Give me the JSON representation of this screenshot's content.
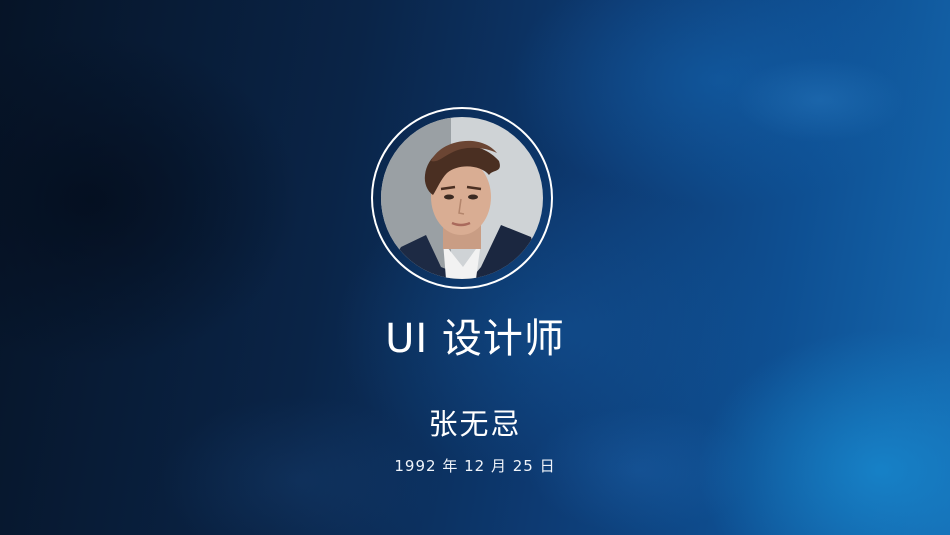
{
  "profile": {
    "title": "UI 设计师",
    "name": "张无忌",
    "birthdate": "1992 年 12 月 25 日"
  },
  "colors": {
    "background_dark": "#061427",
    "background_light": "#1569b0",
    "text": "#ffffff"
  }
}
